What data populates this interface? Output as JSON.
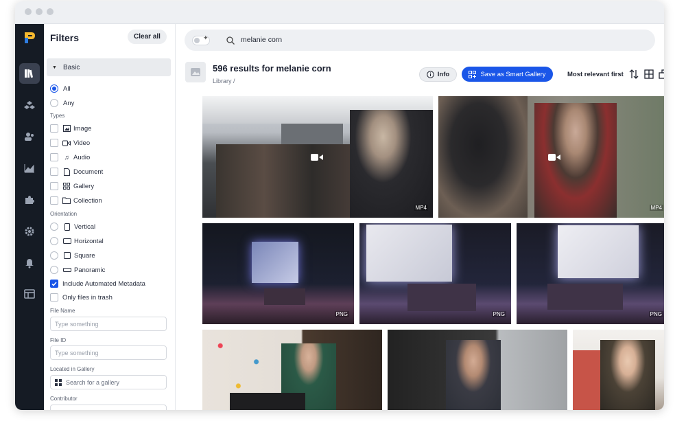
{
  "filters": {
    "title": "Filters",
    "clear_label": "Clear all",
    "basic_label": "Basic",
    "match": [
      {
        "label": "All",
        "selected": true
      },
      {
        "label": "Any",
        "selected": false
      }
    ],
    "types_label": "Types",
    "types": [
      {
        "label": "Image",
        "icon": "image-icon"
      },
      {
        "label": "Video",
        "icon": "video-icon"
      },
      {
        "label": "Audio",
        "icon": "audio-icon"
      },
      {
        "label": "Document",
        "icon": "document-icon"
      },
      {
        "label": "Gallery",
        "icon": "gallery-icon"
      },
      {
        "label": "Collection",
        "icon": "folder-icon"
      }
    ],
    "orientation_label": "Orientation",
    "orientations": [
      {
        "label": "Vertical",
        "icon": "vertical-icon"
      },
      {
        "label": "Horizontal",
        "icon": "horizontal-icon"
      },
      {
        "label": "Square",
        "icon": "square-icon"
      },
      {
        "label": "Panoramic",
        "icon": "panoramic-icon"
      }
    ],
    "automated_metadata": {
      "label": "Include Automated Metadata",
      "checked": true
    },
    "trash": {
      "label": "Only files in trash",
      "checked": false
    },
    "file_name": {
      "label": "File Name",
      "placeholder": "Type something"
    },
    "file_id": {
      "label": "File ID",
      "placeholder": "Type something"
    },
    "gallery": {
      "label": "Located in Gallery",
      "placeholder": "Search for a gallery"
    },
    "contributor": {
      "label": "Contributor"
    }
  },
  "search": {
    "query": "melanie corn"
  },
  "results": {
    "title": "596 results for melanie corn",
    "breadcrumb": "Library /",
    "info_label": "Info",
    "smart_gallery_label": "Save as Smart Gallery",
    "sort_label": "Most relevant first"
  },
  "tiles": [
    {
      "kind": "video",
      "badge": "MP4",
      "scene": "tent-crowd"
    },
    {
      "kind": "video",
      "badge": "MP4",
      "scene": "camera-speaker"
    },
    {
      "kind": "image",
      "badge": "PNG",
      "scene": "stage-panel"
    },
    {
      "kind": "image",
      "badge": "PNG",
      "scene": "stage-panel"
    },
    {
      "kind": "image",
      "badge": "PNG",
      "scene": "stage-panel"
    },
    {
      "kind": "image",
      "badge": "",
      "scene": "podium-speaker"
    },
    {
      "kind": "image",
      "badge": "",
      "scene": "woman-speaker"
    },
    {
      "kind": "image",
      "badge": "",
      "scene": "woman-portrait"
    }
  ],
  "colors": {
    "accent": "#1a56e8",
    "rail": "#151b24"
  }
}
